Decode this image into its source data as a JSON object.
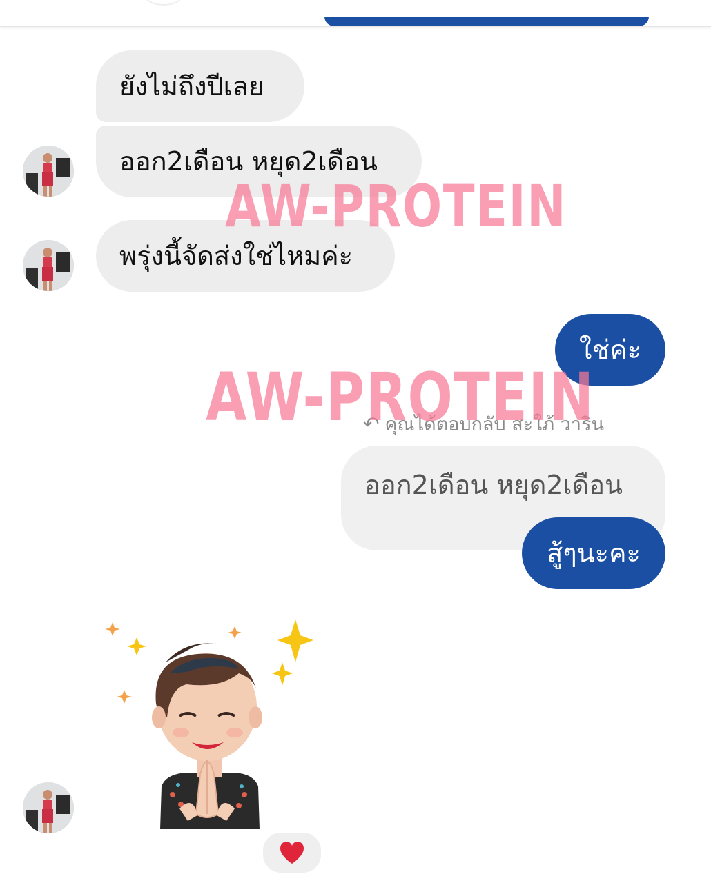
{
  "messages": {
    "m1": {
      "text": "ยังไม่ถึงปีเลย"
    },
    "m2": {
      "text": "ออก2เดือน หยุด2เดือน"
    },
    "m3": {
      "text": "พรุ่งนี้จัดส่งใช่ไหมค่ะ"
    },
    "m4": {
      "text": "ใช่ค่ะ"
    },
    "reply_label": "คุณได้ตอบกลับ สะใภ้ วาริน",
    "quoted": {
      "text": "ออก2เดือน หยุด2เดือน"
    },
    "m5": {
      "text": "สู้ๆนะคะ"
    }
  },
  "watermark": {
    "text1": "AW-PROTEIN",
    "text2": "AW-PROTEIN"
  },
  "sticker": {
    "icon": "praying-avatar-sticker"
  },
  "reaction": {
    "icon": "heart-icon"
  },
  "colors": {
    "outgoing_bubble": "#1a4fa3",
    "incoming_bubble": "#ededed",
    "watermark": "#f87896",
    "heart": "#e0243a"
  }
}
